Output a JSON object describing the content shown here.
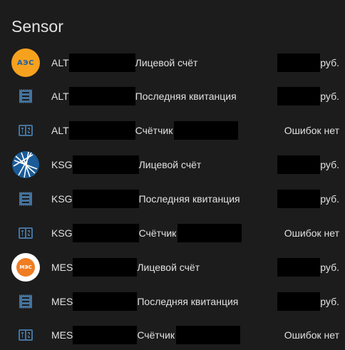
{
  "card": {
    "title": "Sensor"
  },
  "colors": {
    "icon_blue": "#44739e",
    "text": "#e1e1e1",
    "redaction": "#000000",
    "background": "#1c1c1c"
  },
  "rows": [
    {
      "icon": "aes-logo-icon",
      "prefix": "ALT",
      "label": "Лицевой счёт",
      "value": "руб."
    },
    {
      "icon": "receipt-icon",
      "prefix": "ALT",
      "label": "Последняя квитанция",
      "value": "руб."
    },
    {
      "icon": "meter-counter-icon",
      "prefix": "ALT",
      "label": "Счётчик",
      "value": "Ошибок нет"
    },
    {
      "icon": "ksg-logo-icon",
      "prefix": "KSG",
      "label": "Лицевой счёт",
      "value": "руб."
    },
    {
      "icon": "receipt-icon",
      "prefix": "KSG",
      "label": "Последняя квитанция",
      "value": "руб."
    },
    {
      "icon": "meter-counter-icon",
      "prefix": "KSG",
      "label": "Счётчик",
      "value": "Ошибок нет"
    },
    {
      "icon": "mes-logo-icon",
      "prefix": "MES",
      "label": "Лицевой счёт",
      "value": "руб."
    },
    {
      "icon": "receipt-icon",
      "prefix": "MES",
      "label": "Последняя квитанция",
      "value": "руб."
    },
    {
      "icon": "meter-counter-icon",
      "prefix": "MES",
      "label": "Счётчик",
      "value": "Ошибок нет"
    }
  ],
  "logos": {
    "aes": "АЭС",
    "mes": "МЭС"
  }
}
